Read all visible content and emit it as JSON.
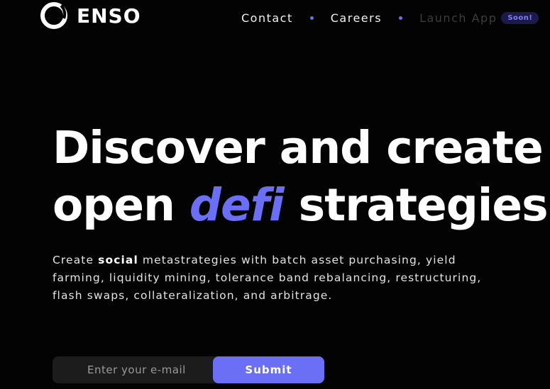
{
  "brand": {
    "name": "ENSO",
    "logo_icon": "enso-circle-icon"
  },
  "nav": {
    "contact": "Contact",
    "careers": "Careers",
    "launch_app": "Launch App",
    "soon_badge": "Soon!"
  },
  "hero": {
    "line1": "Discover and create",
    "line2_before": "open ",
    "line2_accent": "defi",
    "line2_after": " strategies",
    "sub_before": "Create ",
    "sub_bold": "social",
    "sub_after": " metastrategies with batch asset purchasing, yield farming, liquidity mining, tolerance band rebalancing, restructuring, flash swaps, collateralization, and arbitrage."
  },
  "signup": {
    "email_placeholder": "Enter your e-mail",
    "email_value": "",
    "submit_label": "Submit"
  },
  "colors": {
    "accent": "#6b6ff6",
    "background": "#030303",
    "input_bg": "#1c1c1c",
    "badge_bg": "#1c1a4a"
  }
}
